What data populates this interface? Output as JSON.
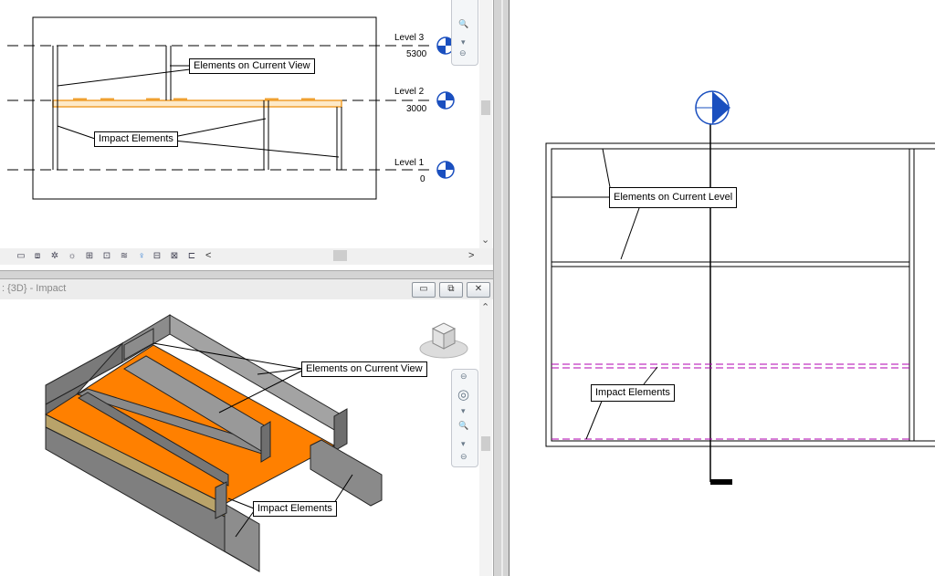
{
  "elevation_view": {
    "levels": [
      {
        "name": "Level 3",
        "elevation": "5300"
      },
      {
        "name": "Level 2",
        "elevation": "3000"
      },
      {
        "name": "Level 1",
        "elevation": "0"
      }
    ],
    "callouts": {
      "current": "Elements on Current View",
      "impact": "Impact Elements"
    },
    "scroll_right_glyph": ">",
    "scroll_down_glyph": "⌄",
    "toolbar_left_glyph": "<"
  },
  "view_3d": {
    "title": ": {3D} - Impact",
    "callouts": {
      "current": "Elements on Current View",
      "impact": "Impact Elements"
    },
    "buttons": {
      "minimize": "▭",
      "restore": "⧉",
      "close": "✕"
    },
    "scroll_up_glyph": "⌃"
  },
  "plan_view": {
    "callouts": {
      "current": "Elements on Current Level",
      "impact": "Impact Elements"
    }
  },
  "colors": {
    "floor_orange": "#ff8000",
    "wall_gray": "#8c8c8c",
    "splitter_gray": "#d4d4d4",
    "nav_blue": "#1a4fbf",
    "impact_magenta": "#b000b0",
    "highlight_orange": "#f0a030"
  }
}
